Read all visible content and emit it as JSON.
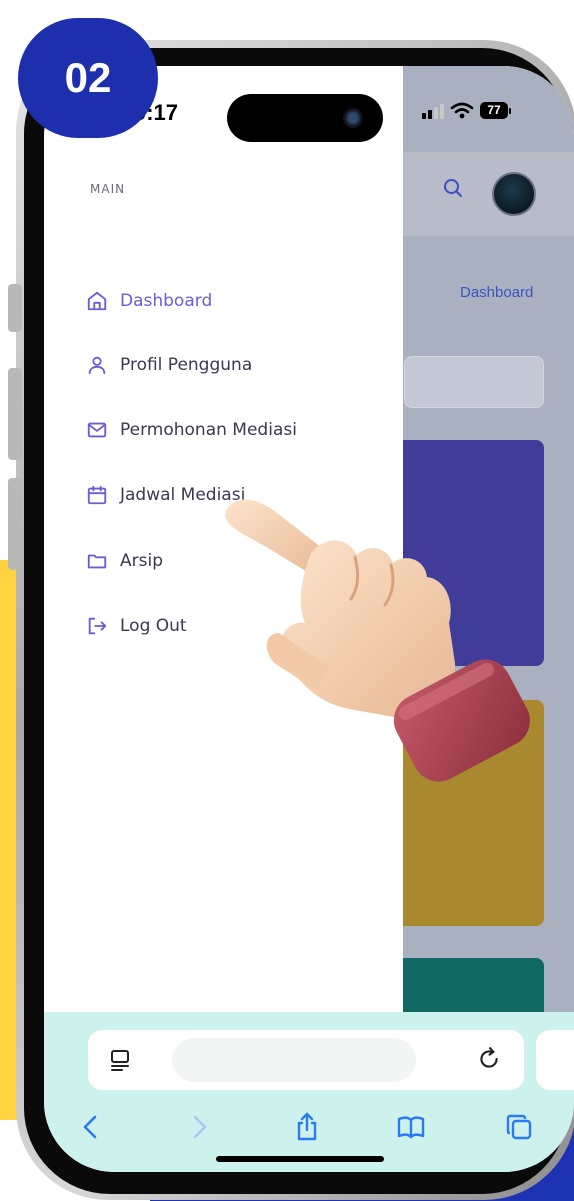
{
  "badge": {
    "label": "02"
  },
  "status_bar": {
    "time": "9:17",
    "battery": "77"
  },
  "sidebar": {
    "section_label": "MAIN",
    "items": [
      {
        "label": "Dashboard",
        "icon": "home-icon",
        "active": true
      },
      {
        "label": "Profil Pengguna",
        "icon": "user-icon",
        "active": false
      },
      {
        "label": "Permohonan Mediasi",
        "icon": "mail-icon",
        "active": false
      },
      {
        "label": "Jadwal Mediasi",
        "icon": "calendar-icon",
        "active": false
      },
      {
        "label": "Arsip",
        "icon": "folder-icon",
        "active": false
      },
      {
        "label": "Log Out",
        "icon": "logout-icon",
        "active": false
      }
    ]
  },
  "page": {
    "breadcrumb": "Dashboard"
  },
  "colors": {
    "accent": "#6a5cd8",
    "badge": "#1e2fae",
    "card_1": "#413c9a",
    "card_2": "#a98930",
    "card_3": "#106962",
    "safari_bar": "#cdf2ee",
    "yellow_decoration": "#ffd440"
  },
  "browser": {
    "icons": [
      "reader-icon",
      "reload-icon",
      "back-icon",
      "forward-icon",
      "share-icon",
      "bookmarks-icon",
      "tabs-icon"
    ]
  }
}
